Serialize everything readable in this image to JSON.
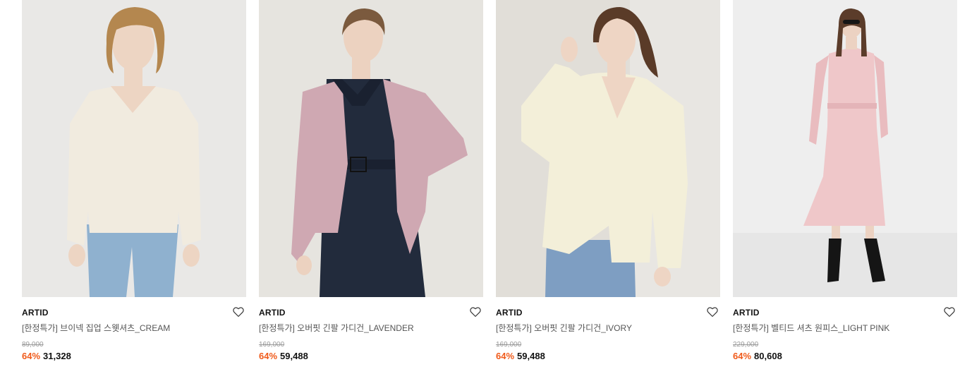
{
  "products": [
    {
      "brand": "ARTID",
      "name": "[한정특가] 브이넥 집업 스웻셔츠_CREAM",
      "original_price": "89,000",
      "discount": "64%",
      "sale_price": "31,328",
      "colors": {
        "bg": "#e9e8e6",
        "top": "#f1ebdf",
        "bottom": "#8fb1cf",
        "hair": "#b4874f",
        "skin": "#edd5c3"
      }
    },
    {
      "brand": "ARTID",
      "name": "[한정특가] 오버핏 긴팔 가디건_LAVENDER",
      "original_price": "169,000",
      "discount": "64%",
      "sale_price": "59,488",
      "colors": {
        "bg": "#e6e4df",
        "top": "#cfa8b2",
        "inner": "#222b3c",
        "hair": "#7b5a3e",
        "skin": "#ecd2c0"
      }
    },
    {
      "brand": "ARTID",
      "name": "[한정특가] 오버핏 긴팔 가디건_IVORY",
      "original_price": "169,000",
      "discount": "64%",
      "sale_price": "59,488",
      "colors": {
        "bg": "#e8e6e2",
        "top": "#f3efd9",
        "bottom": "#7e9ec2",
        "hair": "#5a3b28",
        "skin": "#eed5c4"
      }
    },
    {
      "brand": "ARTID",
      "name": "[한정특가] 벨티드 셔츠 원피스_LIGHT PINK",
      "original_price": "229,000",
      "discount": "64%",
      "sale_price": "80,608",
      "colors": {
        "bg": "#eeeeee",
        "top": "#efc7c9",
        "shoes": "#151515",
        "hair": "#5b3c2a",
        "skin": "#ecd2c2"
      }
    }
  ],
  "icons": {
    "wishlist": "heart-outline-icon"
  },
  "accent": "#f05a1a"
}
